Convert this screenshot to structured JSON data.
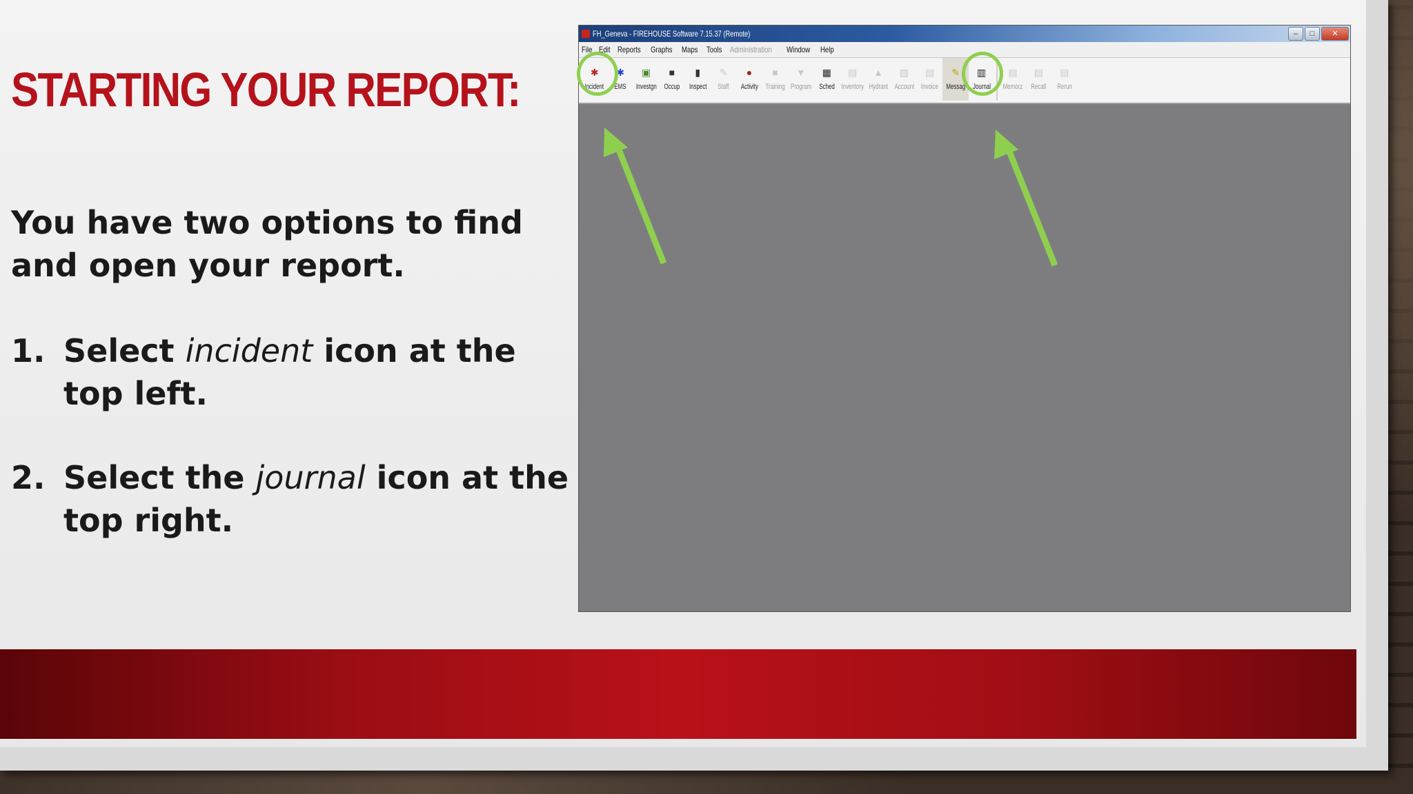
{
  "slide": {
    "title": "Starting your report:",
    "intro": "You have two options to find and open your report.",
    "steps": [
      {
        "number": "1.",
        "prefix": "Select ",
        "emphasis": "incident",
        "suffix": " icon at the top left."
      },
      {
        "number": "2.",
        "prefix": "Select the ",
        "emphasis": "journal",
        "suffix": " icon at the top right."
      }
    ]
  },
  "app": {
    "title": "FH_Geneva - FIREHOUSE Software 7.15.37 (Remote)",
    "window_controls": [
      "–",
      "□",
      "✕"
    ],
    "menus": [
      {
        "label": "File",
        "enabled": true
      },
      {
        "label": "Edit",
        "enabled": true
      },
      {
        "label": "Reports",
        "enabled": true
      },
      {
        "label": "Graphs",
        "enabled": true
      },
      {
        "label": "Maps",
        "enabled": true
      },
      {
        "label": "Tools",
        "enabled": true
      },
      {
        "label": "Administration",
        "enabled": false
      },
      {
        "label": "Window",
        "enabled": true
      },
      {
        "label": "Help",
        "enabled": true
      }
    ],
    "toolbar": [
      {
        "label": "Incident",
        "icon": "incident-icon",
        "glyph": "✱",
        "color": "#b3261e",
        "enabled": true
      },
      {
        "label": "EMS",
        "icon": "ems-icon",
        "glyph": "✱",
        "color": "#1f3fd1",
        "enabled": true
      },
      {
        "label": "Investgn",
        "icon": "investigation-icon",
        "glyph": "▣",
        "color": "#4e8a2c",
        "enabled": true
      },
      {
        "label": "Occup",
        "icon": "occupancy-icon",
        "glyph": "■",
        "color": "#333333",
        "enabled": true
      },
      {
        "label": "Inspect",
        "icon": "inspect-icon",
        "glyph": "▮",
        "color": "#333333",
        "enabled": true
      },
      {
        "label": "Staff",
        "icon": "staff-icon",
        "glyph": "✎",
        "color": "#777777",
        "enabled": false
      },
      {
        "label": "Activity",
        "icon": "activity-icon",
        "glyph": "●",
        "color": "#a0281b",
        "enabled": true
      },
      {
        "label": "Training",
        "icon": "training-icon",
        "glyph": "■",
        "color": "#777777",
        "enabled": false
      },
      {
        "label": "Program",
        "icon": "program-icon",
        "glyph": "▼",
        "color": "#777777",
        "enabled": false
      },
      {
        "label": "Sched",
        "icon": "schedule-icon",
        "glyph": "▦",
        "color": "#222222",
        "enabled": true
      },
      {
        "label": "Inventory",
        "icon": "inventory-icon",
        "glyph": "▤",
        "color": "#777777",
        "enabled": false
      },
      {
        "label": "Hydrant",
        "icon": "hydrant-icon",
        "glyph": "▲",
        "color": "#777777",
        "enabled": false
      },
      {
        "label": "Account",
        "icon": "account-icon",
        "glyph": "▧",
        "color": "#777777",
        "enabled": false
      },
      {
        "label": "Invoice",
        "icon": "invoice-icon",
        "glyph": "▤",
        "color": "#777777",
        "enabled": false
      },
      {
        "label": "Messag",
        "icon": "message-icon",
        "glyph": "✎",
        "color": "#c9a100",
        "enabled": true,
        "pressed": true
      },
      {
        "label": "Journal",
        "icon": "journal-icon",
        "glyph": "▥",
        "color": "#222222",
        "enabled": true
      },
      {
        "label": "Memorz",
        "icon": "memorize-icon",
        "glyph": "▤",
        "color": "#777777",
        "enabled": false,
        "group_start": true
      },
      {
        "label": "Recall",
        "icon": "recall-icon",
        "glyph": "▤",
        "color": "#777777",
        "enabled": false
      },
      {
        "label": "Rerun",
        "icon": "rerun-icon",
        "glyph": "▤",
        "color": "#777777",
        "enabled": false
      }
    ]
  },
  "annotation": {
    "highlight_color": "#8fcf4f"
  }
}
